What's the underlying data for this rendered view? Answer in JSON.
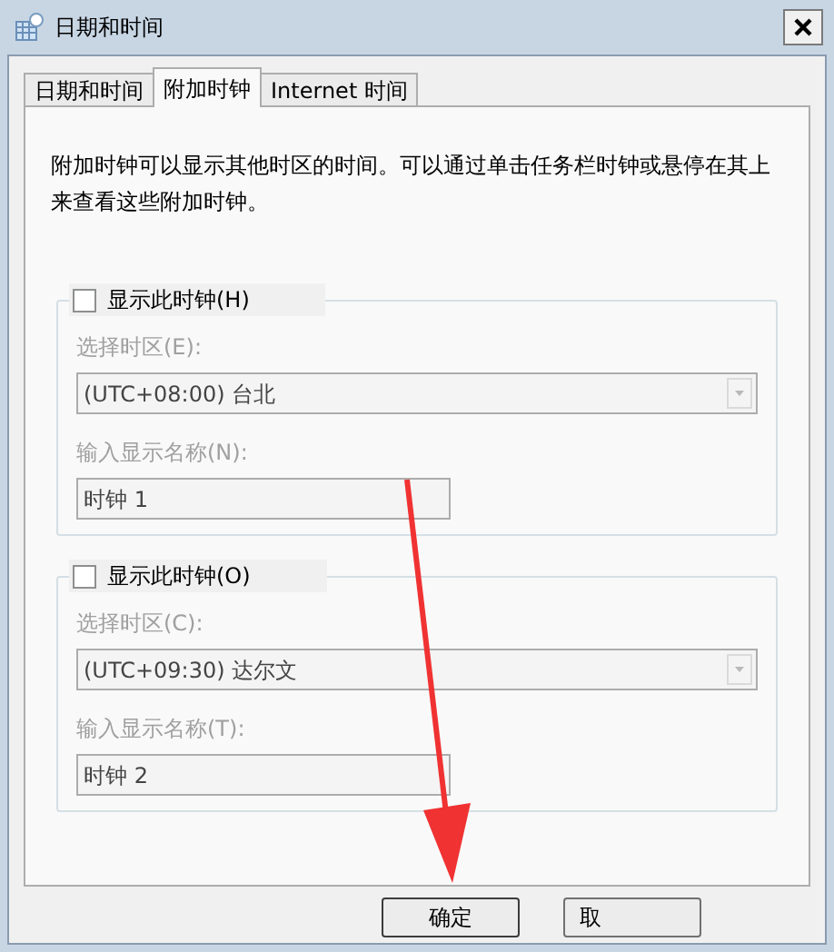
{
  "window": {
    "title": "日期和时间"
  },
  "tabs": [
    {
      "label": "日期和时间",
      "selected": false
    },
    {
      "label": "附加时钟",
      "selected": true
    },
    {
      "label": "Internet 时间",
      "selected": false
    }
  ],
  "description": "附加时钟可以显示其他时区的时间。可以通过单击任务栏时钟或悬停在其上来查看这些附加时钟。",
  "clocks": [
    {
      "label": "显示此时钟(H)",
      "checked": false,
      "disabled": true,
      "timezone_label": "选择时区(E):",
      "timezone": "(UTC+08:00) 台北",
      "name_label": "输入显示名称(N):",
      "name": "时钟 1"
    },
    {
      "label": "显示此时钟(O)",
      "checked": false,
      "disabled": true,
      "timezone_label": "选择时区(C):",
      "timezone": "(UTC+09:30) 达尔文",
      "name_label": "输入显示名称(T):",
      "name": "时钟 2"
    }
  ],
  "buttons": [
    "确定",
    "取"
  ]
}
